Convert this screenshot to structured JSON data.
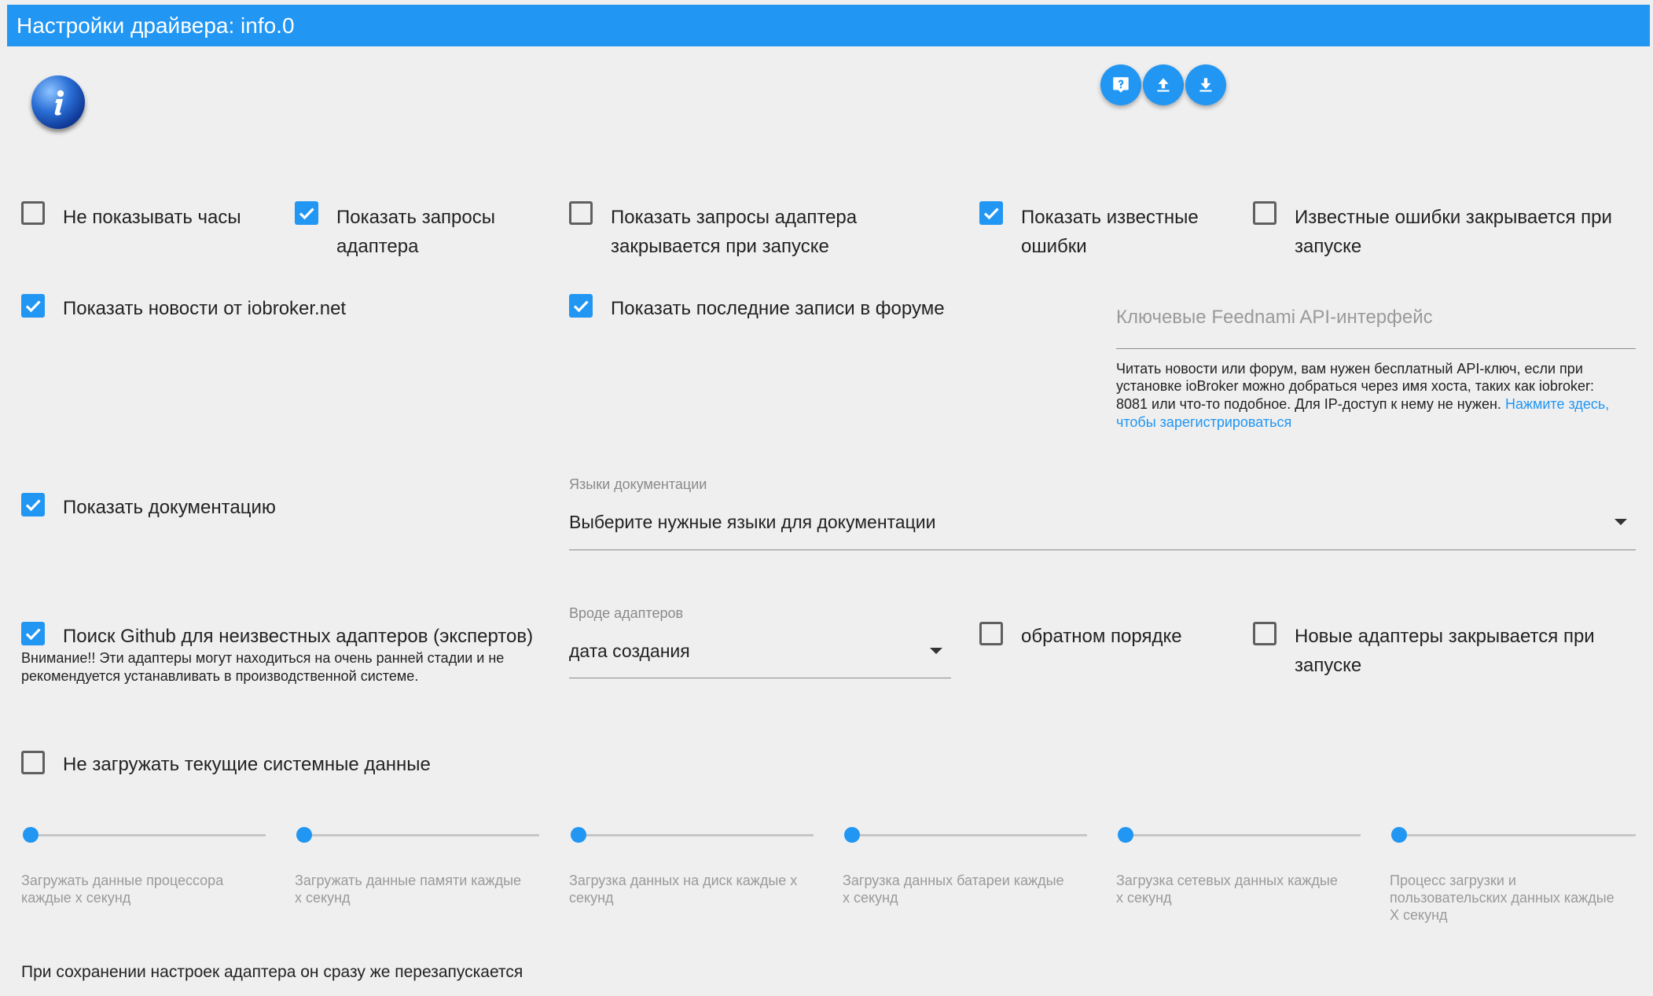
{
  "header": {
    "title": "Настройки драйвера: info.0"
  },
  "toolbar": {
    "help_icon": "help-icon",
    "upload_icon": "upload-icon",
    "download_icon": "download-icon"
  },
  "options": {
    "hide_clock": {
      "label": "Не показывать часы",
      "checked": false
    },
    "show_adapter_requests": {
      "label_line1": "Показать запросы",
      "label_line2": "адаптера",
      "checked": true
    },
    "adapter_requests_closed": {
      "label_line1": "Показать запросы адаптера",
      "label_line2": "закрывается при запуске",
      "checked": false
    },
    "show_known_errors": {
      "label_line1": "Показать известные",
      "label_line2": "ошибки",
      "checked": true
    },
    "known_errors_closed": {
      "label_line1": "Известные ошибки закрывается при",
      "label_line2": "запуске",
      "checked": false
    },
    "show_news": {
      "label": "Показать новости от iobroker.net",
      "checked": true
    },
    "show_forum": {
      "label": "Показать последние записи в форуме",
      "checked": true
    },
    "show_docs": {
      "label": "Показать документацию",
      "checked": true
    },
    "github_search": {
      "label": "Поиск Github для неизвестных адаптеров (экспертов)",
      "hint_line1": "Внимание!! Эти адаптеры могут находиться на очень ранней стадии и не",
      "hint_line2": "рекомендуется устанавливать в производственной системе.",
      "checked": true
    },
    "reverse_order": {
      "label": "обратном порядке",
      "checked": false
    },
    "new_adapters_closed": {
      "label_line1": "Новые адаптеры закрывается при",
      "label_line2": "запуске",
      "checked": false
    },
    "no_system_data": {
      "label": "Не загружать текущие системные данные",
      "checked": false
    }
  },
  "feednami": {
    "placeholder": "Ключевые Feednami API-интерфейс",
    "help_line1": "Читать новости или форум, вам нужен бесплатный API-ключ, если при",
    "help_line2": "установке ioBroker можно добраться через имя хоста, таких как iobroker:",
    "help_line3": "8081 или что-то подобное. Для IP-доступ к нему не нужен.",
    "link_part1": "Нажмите здесь,",
    "link_part2": "чтобы зарегистрироваться"
  },
  "doc_languages": {
    "label": "Языки документации",
    "value": "Выберите нужные языки для документации"
  },
  "sort_adapters": {
    "label": "Вроде адаптеров",
    "value": "дата создания"
  },
  "sliders": [
    {
      "line1": "Загружать данные процессора",
      "line2": "каждые х секунд",
      "line3": "",
      "value": 0
    },
    {
      "line1": "Загружать данные памяти каждые",
      "line2": "х секунд",
      "line3": "",
      "value": 0
    },
    {
      "line1": "Загрузка данных на диск каждые х",
      "line2": "секунд",
      "line3": "",
      "value": 0
    },
    {
      "line1": "Загрузка данных батареи каждые",
      "line2": "х секунд",
      "line3": "",
      "value": 0
    },
    {
      "line1": "Загрузка сетевых данных каждые",
      "line2": "х секунд",
      "line3": "",
      "value": 0
    },
    {
      "line1": "Процесс загрузки и",
      "line2": "пользовательских данных каждые",
      "line3": "Х секунд",
      "value": 0
    }
  ],
  "footer": {
    "text": "При сохранении настроек адаптера он сразу же перезапускается"
  },
  "colors": {
    "accent": "#2196f3",
    "background": "#efefef"
  }
}
